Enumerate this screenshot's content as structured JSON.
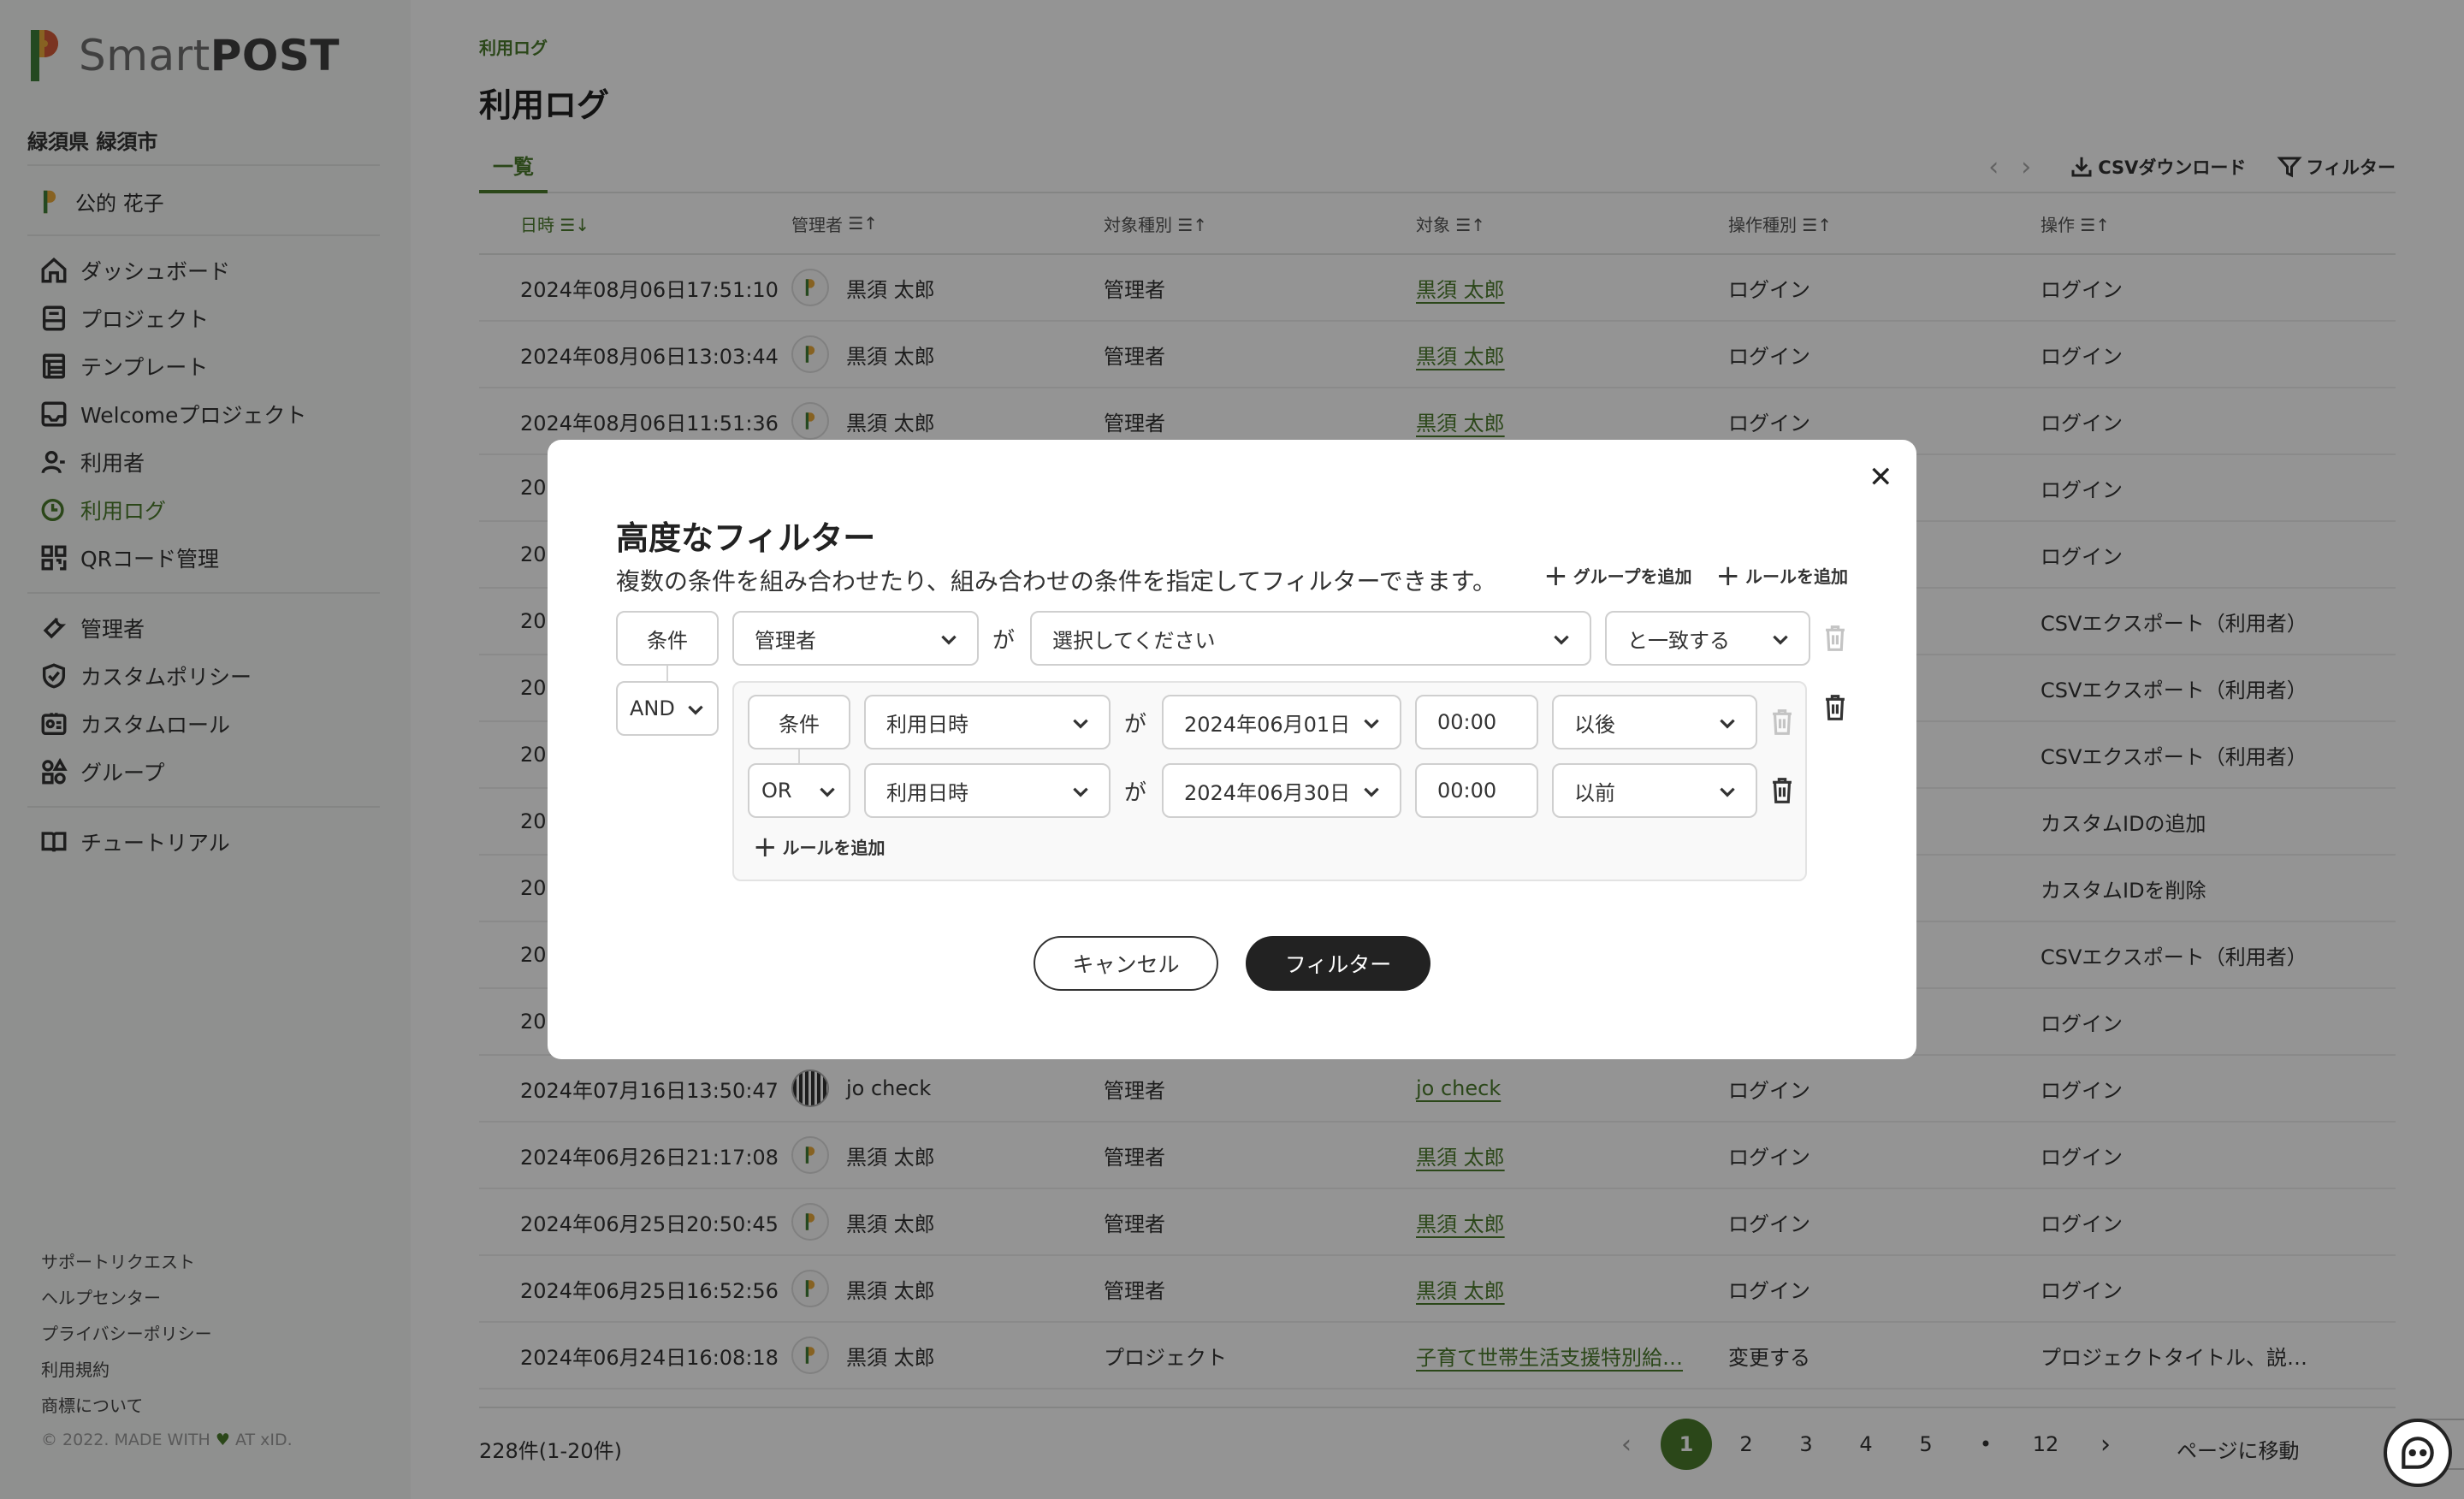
{
  "brand": {
    "name_light": "Smart",
    "name_bold": "POST"
  },
  "sidebar": {
    "org": "緑須県 緑須市",
    "user": "公的 花子",
    "nav_main": [
      {
        "label": "ダッシュボード",
        "icon": "home-icon"
      },
      {
        "label": "プロジェクト",
        "icon": "project-icon"
      },
      {
        "label": "テンプレート",
        "icon": "template-icon"
      },
      {
        "label": "Welcomeプロジェクト",
        "icon": "welcome-icon"
      },
      {
        "label": "利用者",
        "icon": "user-icon"
      },
      {
        "label": "利用ログ",
        "icon": "log-icon",
        "active": true
      },
      {
        "label": "QRコード管理",
        "icon": "qr-icon"
      }
    ],
    "nav_admin": [
      {
        "label": "管理者",
        "icon": "wrench-icon"
      },
      {
        "label": "カスタムポリシー",
        "icon": "shield-icon"
      },
      {
        "label": "カスタムロール",
        "icon": "id-card-icon"
      },
      {
        "label": "グループ",
        "icon": "group-icon"
      }
    ],
    "nav_help": [
      {
        "label": "チュートリアル",
        "icon": "book-icon"
      }
    ],
    "footer_links": [
      "サポートリクエスト",
      "ヘルプセンター",
      "プライバシーポリシー",
      "利用規約",
      "商標について"
    ],
    "copyright_left": "© 2022. MADE WITH",
    "copyright_right": "AT xID."
  },
  "page": {
    "breadcrumb": "利用ログ",
    "title": "利用ログ",
    "tab": "一覧",
    "csv_label": "CSVダウンロード",
    "filter_label": "フィルター"
  },
  "table": {
    "headers": [
      "日時",
      "管理者",
      "対象種別",
      "対象",
      "操作種別",
      "操作"
    ],
    "rows": [
      [
        "2024年08月06日17:51:10",
        "黒須 太郎",
        "管理者",
        "黒須 太郎",
        "ログイン",
        "ログイン"
      ],
      [
        "2024年08月06日13:03:44",
        "黒須 太郎",
        "管理者",
        "黒須 太郎",
        "ログイン",
        "ログイン"
      ],
      [
        "2024年08月06日11:51:36",
        "黒須 太郎",
        "管理者",
        "黒須 太郎",
        "ログイン",
        "ログイン"
      ],
      [
        "202",
        "",
        "",
        "",
        "",
        "ログイン"
      ],
      [
        "202",
        "",
        "",
        "",
        "",
        "ログイン"
      ],
      [
        "202",
        "",
        "",
        "",
        "",
        "CSVエクスポート（利用者）"
      ],
      [
        "202",
        "",
        "",
        "",
        "",
        "CSVエクスポート（利用者）"
      ],
      [
        "202",
        "",
        "",
        "",
        "",
        "CSVエクスポート（利用者）"
      ],
      [
        "202",
        "",
        "",
        "",
        "",
        "カスタムIDの追加"
      ],
      [
        "202",
        "",
        "",
        "",
        "",
        "カスタムIDを削除"
      ],
      [
        "202",
        "",
        "",
        "",
        "",
        "CSVエクスポート（利用者）"
      ],
      [
        "202",
        "",
        "",
        "",
        "",
        "ログイン"
      ],
      [
        "2024年07月16日13:50:47",
        "jo check",
        "管理者",
        "jo check",
        "ログイン",
        "ログイン"
      ],
      [
        "2024年06月26日21:17:08",
        "黒須 太郎",
        "管理者",
        "黒須 太郎",
        "ログイン",
        "ログイン"
      ],
      [
        "2024年06月25日20:50:45",
        "黒須 太郎",
        "管理者",
        "黒須 太郎",
        "ログイン",
        "ログイン"
      ],
      [
        "2024年06月25日16:52:56",
        "黒須 太郎",
        "管理者",
        "黒須 太郎",
        "ログイン",
        "ログイン"
      ],
      [
        "2024年06月24日16:08:18",
        "黒須 太郎",
        "プロジェクト",
        "子育て世帯生活支援特別給…",
        "変更する",
        "プロジェクトタイトル、説…"
      ]
    ]
  },
  "pagination": {
    "count": "228件(1-20件)",
    "pages": [
      "1",
      "2",
      "3",
      "4",
      "5",
      "•",
      "12"
    ],
    "current": "1",
    "goto_label": "ページに移動",
    "goto_value": "1"
  },
  "modal": {
    "title": "高度なフィルター",
    "description": "複数の条件を組み合わせたり、組み合わせの条件を指定してフィルターできます。",
    "add_group": "グループを追加",
    "add_rule": "ルールを追加",
    "condition_label": "条件",
    "ga": "が",
    "rule1": {
      "field": "管理者",
      "value_placeholder": "選択してください",
      "op": "と一致する"
    },
    "group_logic": "AND",
    "group_rule1": {
      "field": "利用日時",
      "date": "2024年06月01日",
      "time": "00:00",
      "op": "以後"
    },
    "group_rule2_logic": "OR",
    "group_rule2": {
      "field": "利用日時",
      "date": "2024年06月30日",
      "time": "00:00",
      "op": "以前"
    },
    "inner_add_rule": "ルールを追加",
    "cancel": "キャンセル",
    "submit": "フィルター"
  },
  "colors": {
    "accent": "#4a7a2c",
    "overlay": "rgba(0,0,0,0.42)",
    "primary_button": "#222222"
  }
}
